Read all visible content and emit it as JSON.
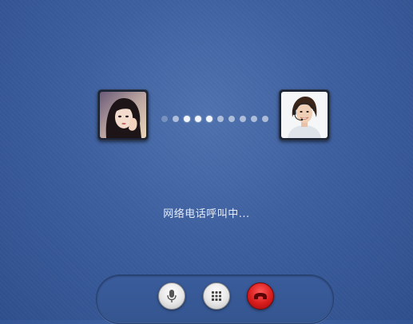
{
  "call": {
    "status": "网络电话呼叫中..."
  },
  "participants": {
    "caller_icon": "caller-avatar-photo",
    "callee_icon": "callee-avatar-photo"
  },
  "progress": {
    "total_dots": 10,
    "active_dots": [
      2,
      3,
      4,
      5,
      6,
      7,
      8,
      9
    ]
  },
  "controls": {
    "mic_icon": "microphone-icon",
    "keypad_icon": "keypad-icon",
    "hangup_icon": "hang-up-icon",
    "hangup_color": "#d81c1c"
  },
  "theme": {
    "background": "#3d5f9f",
    "text": "#e6ecf7"
  }
}
